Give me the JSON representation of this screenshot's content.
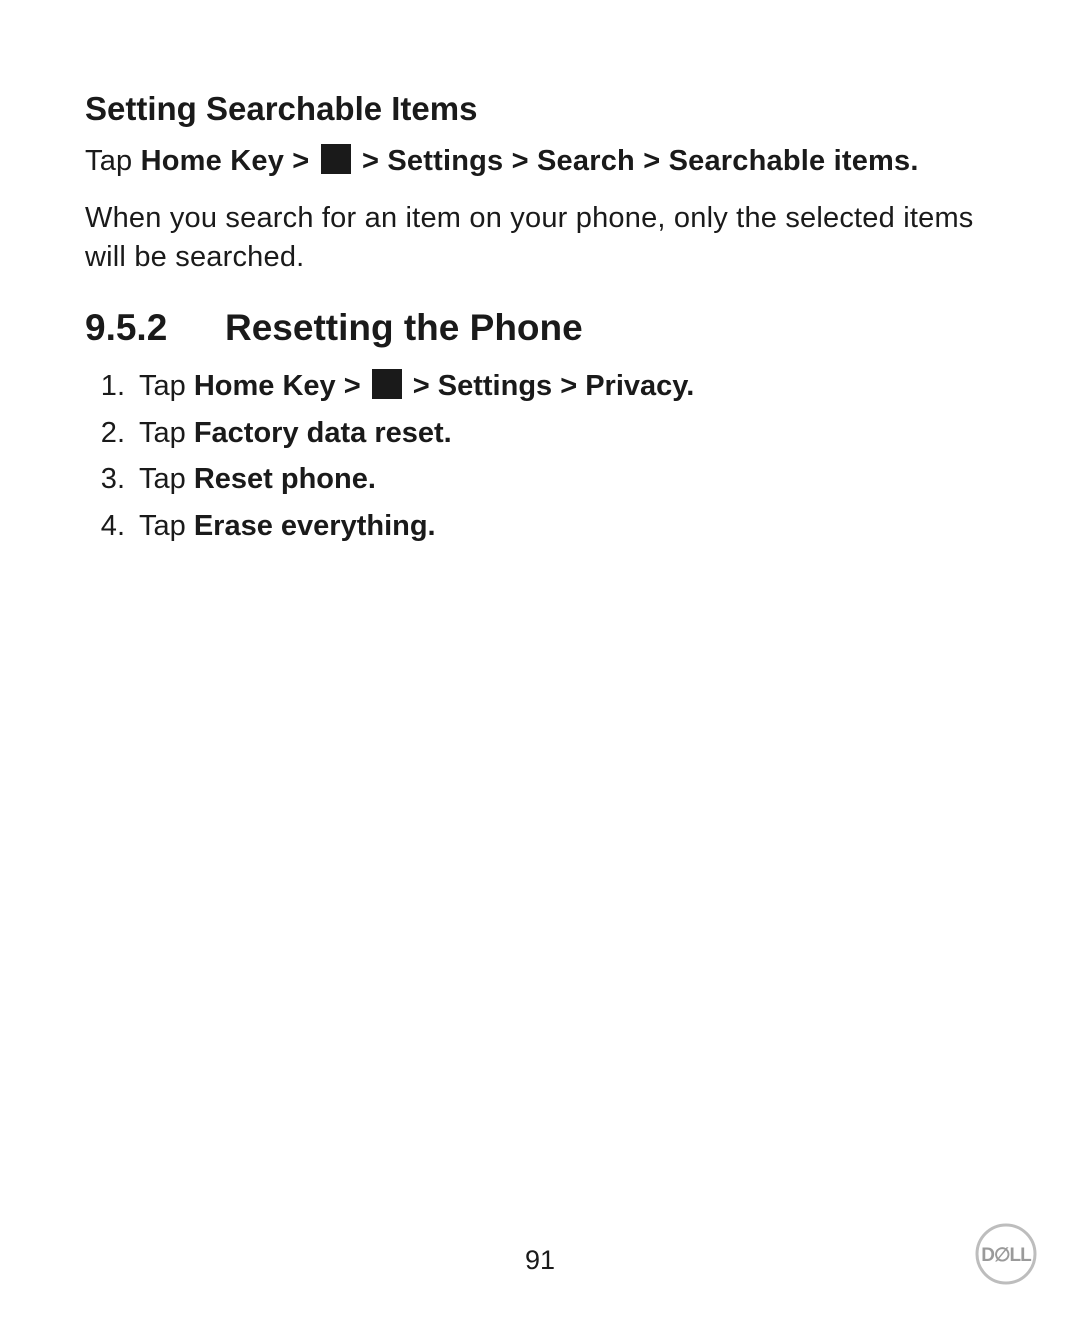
{
  "section1": {
    "heading": "Setting Searchable Items",
    "line1_pre": "Tap ",
    "line1_bold_a": "Home Key > ",
    "line1_bold_b": " > Settings > Search > Searchable items.",
    "line2": "When you search for an item on your phone, only the selected items will be searched."
  },
  "section2": {
    "number": "9.5.2",
    "title": "Resetting the Phone",
    "steps": [
      {
        "pre": "Tap ",
        "bold_a": "Home Key > ",
        "has_icon": true,
        "bold_b": " > Settings > Privacy."
      },
      {
        "pre": "Tap ",
        "bold_a": "Factory data reset.",
        "has_icon": false,
        "bold_b": ""
      },
      {
        "pre": "Tap ",
        "bold_a": "Reset phone.",
        "has_icon": false,
        "bold_b": ""
      },
      {
        "pre": "Tap ",
        "bold_a": "Erase everything.",
        "has_icon": false,
        "bold_b": ""
      }
    ]
  },
  "page_number": "91",
  "logo_text": "DELL"
}
